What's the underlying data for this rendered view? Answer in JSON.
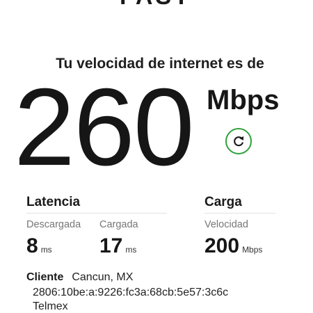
{
  "brand": {
    "logo_text": "FAST"
  },
  "headline": "Tu velocidad de internet es de",
  "speed": {
    "value": "260",
    "unit": "Mbps"
  },
  "refresh": {
    "icon": "refresh-icon",
    "color": "#2fa23a"
  },
  "latency": {
    "title": "Latencia",
    "download": {
      "label": "Descargada",
      "value": "8",
      "unit": "ms"
    },
    "upload": {
      "label": "Cargada",
      "value": "17",
      "unit": "ms"
    }
  },
  "upload_section": {
    "title": "Carga",
    "speed": {
      "label": "Velocidad",
      "value": "200",
      "unit": "Mbps"
    }
  },
  "client": {
    "label": "Cliente",
    "location": "Cancun, MX",
    "ip": "2806:10be:a:9226:fc3a:68cb:5e57:3c6c",
    "isp": "Telmex"
  }
}
